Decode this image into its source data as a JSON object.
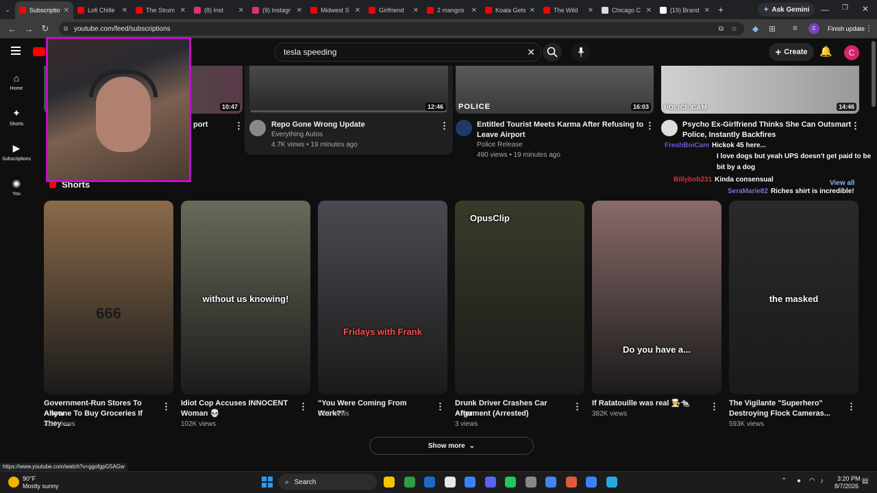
{
  "browser": {
    "tabs": [
      {
        "title": "Subscriptio",
        "color": "#ff0000",
        "active": true
      },
      {
        "title": "Lofi Chille",
        "color": "#ff0000"
      },
      {
        "title": "The Strum",
        "color": "#ff0000"
      },
      {
        "title": "(8) Inst",
        "color": "#e1306c"
      },
      {
        "title": "(9) Instagr",
        "color": "#e1306c"
      },
      {
        "title": "Midwest S",
        "color": "#ff0000"
      },
      {
        "title": "Girlfriend",
        "color": "#ff0000"
      },
      {
        "title": "2 mangos",
        "color": "#ff0000"
      },
      {
        "title": "Koala Gets",
        "color": "#ff0000"
      },
      {
        "title": "The Wild",
        "color": "#ff0000"
      },
      {
        "title": "Chicago C",
        "color": "#dddddd"
      },
      {
        "title": "(19) Brand",
        "color": "#ffffff"
      }
    ],
    "new_tab": "+",
    "ask_gemini": "Ask Gemini",
    "url": "youtube.com/feed/subscriptions",
    "finish_update": "Finish update",
    "profile_letter": "c"
  },
  "youtube": {
    "search_query": "tesla speeding",
    "create_label": "Create",
    "avatar_letter": "C",
    "guide": [
      {
        "icon": "⌂",
        "label": "Home"
      },
      {
        "icon": "✦",
        "label": "Shorts"
      },
      {
        "icon": "▶",
        "label": "Subscriptions"
      },
      {
        "icon": "◉",
        "label": "You"
      }
    ],
    "videos": [
      {
        "title": "port",
        "duration": "10:47"
      },
      {
        "title": "Repo Gone Wrong Update",
        "channel": "Everything Autos",
        "meta": "4.7K views • 19 minutes ago",
        "duration": "12:46"
      },
      {
        "title_l1": "Entitled Tourist Meets Karma After Refusing to",
        "title_l2": "Leave Airport",
        "channel": "Police Release",
        "meta": "490 views • 19 minutes ago",
        "duration": "16:03",
        "overlay": "POLICE"
      },
      {
        "title_l1": "Psycho Ex-Girlfriend Thinks She Can Outsmart",
        "title_l2": "Police, Instantly Backfires",
        "duration": "14:46",
        "overlay": "POLICE CAM"
      }
    ],
    "shorts_heading": "Shorts",
    "shorts": [
      {
        "title_l1": "Government-Run Stores To Allow",
        "title_l2": "Anyone To Buy Groceries If They ...",
        "views": "31K views",
        "caption": "666",
        "bg": "#8a6a4a"
      },
      {
        "title_l1": "Idiot Cop Accuses INNOCENT",
        "title_l2": "Woman 💀",
        "views": "102K views",
        "caption": "without us knowing!",
        "bg": "#6a6a5a"
      },
      {
        "title_l1": "\"You Were Coming From Work?\"",
        "title_l2": "",
        "views": "41K views",
        "caption": "Fridays with Frank",
        "bg": "#4a4a52"
      },
      {
        "title_l1": "Drunk Driver Crashes Car After",
        "title_l2": "Argument (Arrested)",
        "views": "3 views",
        "caption": "OpusClip",
        "bg": "#3a3a2a"
      },
      {
        "title_l1": "If Ratatouille was real 🧑‍🍳🐀",
        "title_l2": "",
        "views": "382K views",
        "caption": "Do you have a...",
        "bg": "#8a6a6a"
      },
      {
        "title_l1": "The Vigilante \"Superhero\"",
        "title_l2": "Destroying Flock Cameras...",
        "views": "593K views",
        "caption": "the masked",
        "bg": "#2a2a2a"
      }
    ],
    "show_more": "Show more",
    "status_url": "https://www.youtube.com/watch?v=ggofgpG5AGw"
  },
  "chat": {
    "messages": [
      {
        "user": "FreshBoiCam",
        "text": "Hickok 45 here...",
        "color": "#6a5acd"
      },
      {
        "user": "",
        "text": "I love dogs but yeah UPS doesn't get paid to be",
        "color": "#aaaaaa"
      },
      {
        "user": "",
        "text": "bit by a dog",
        "color": "#aaaaaa"
      },
      {
        "user": "Billybob231",
        "text": "Kinda consensual",
        "color": "#e03030"
      },
      {
        "user": "SeraMarie82",
        "text": "Riches shirt is incredible!",
        "color": "#8a6ad8"
      }
    ],
    "view_all": "View all"
  },
  "taskbar": {
    "weather_temp": "90°F",
    "weather_desc": "Mostly sunny",
    "search_label": "Search",
    "time": "3:20 PM",
    "date": "8/7/2026"
  }
}
